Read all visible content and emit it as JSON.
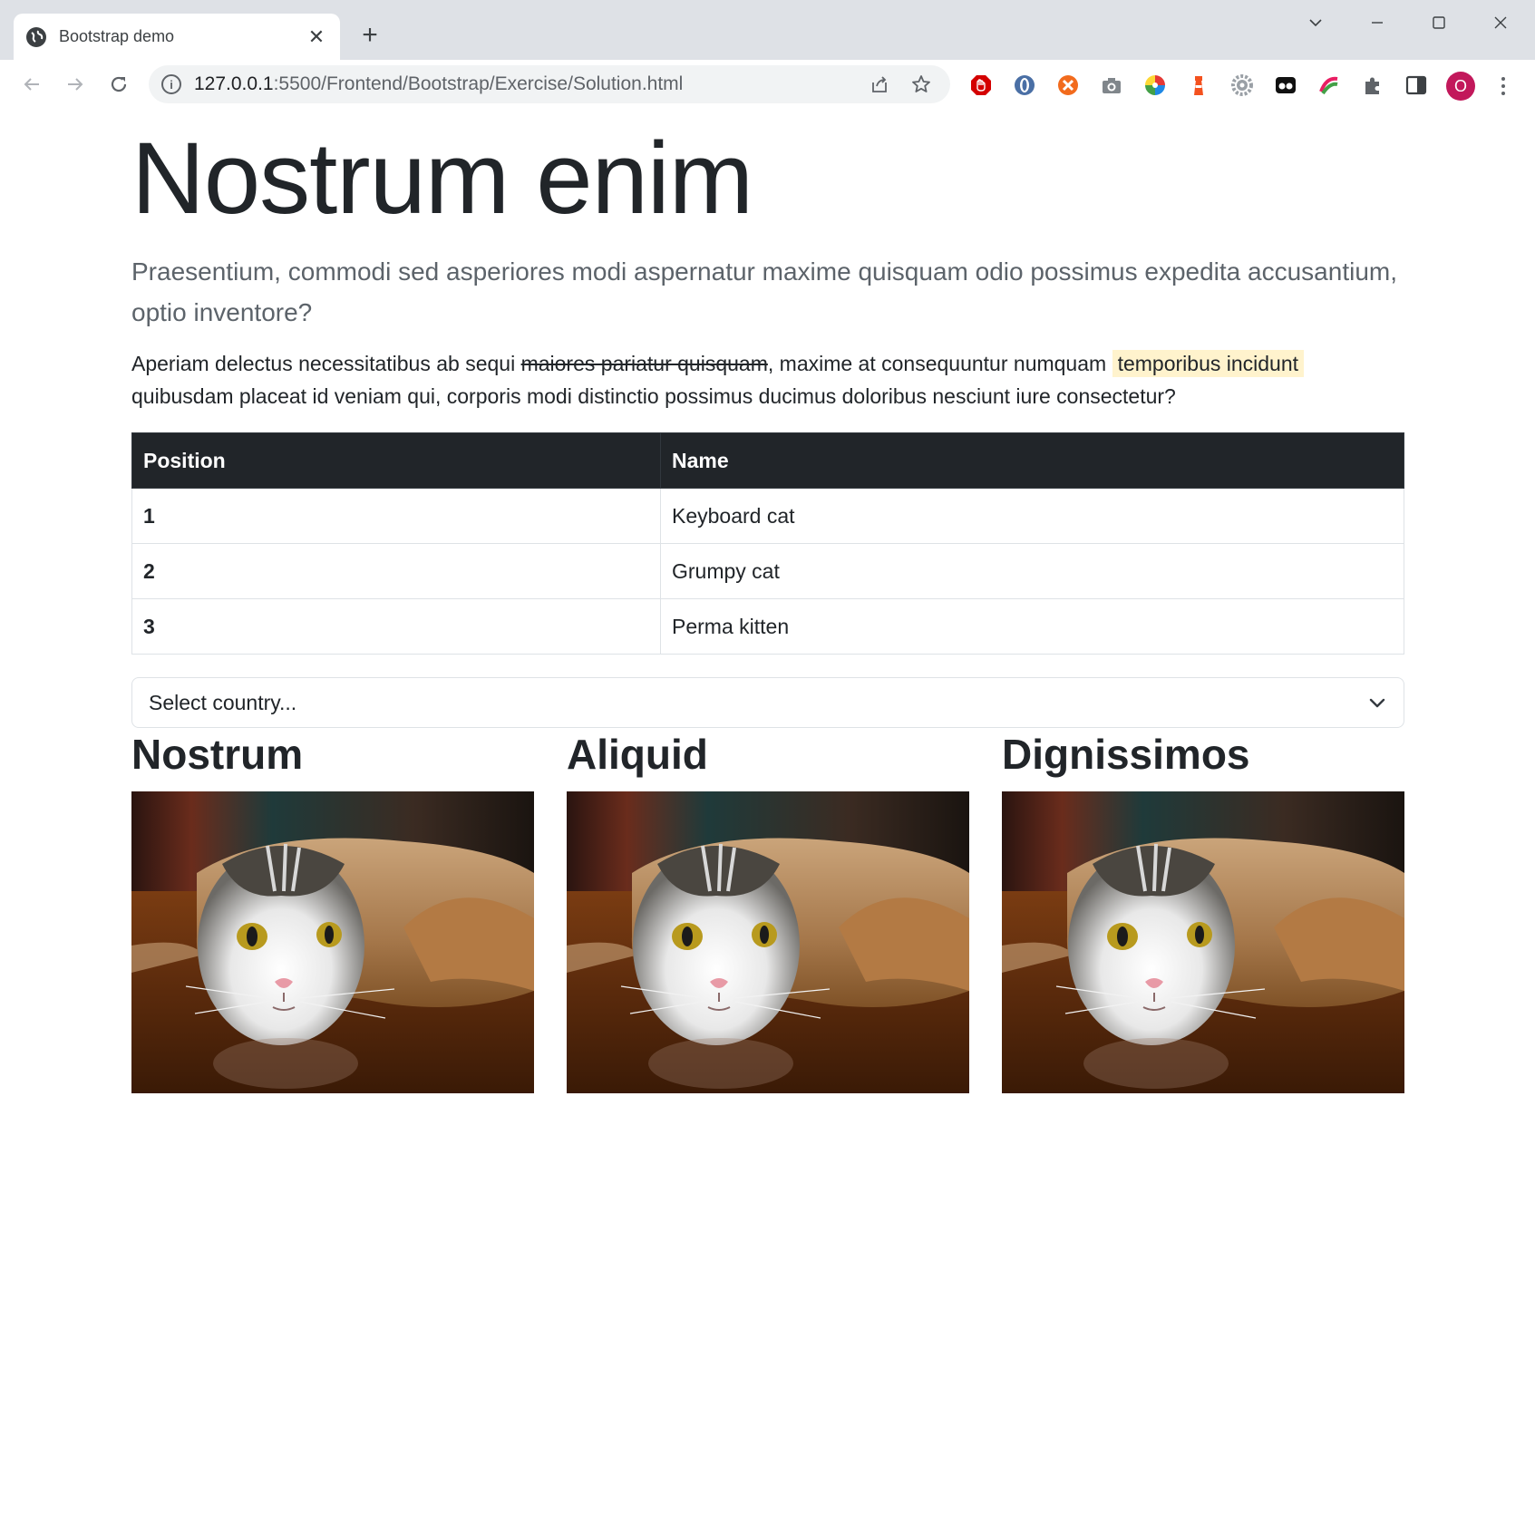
{
  "browser": {
    "tab_title": "Bootstrap demo",
    "url_host": "127.0.0.1",
    "url_rest": ":5500/Frontend/Bootstrap/Exercise/Solution.html",
    "profile_initial": "O"
  },
  "page": {
    "heading": "Nostrum enim",
    "lead": "Praesentium, commodi sed asperiores modi aspernatur maxime quisquam odio possimus expedita accusantium, optio inventore?",
    "paragraph": {
      "before_del": "Aperiam delectus necessitatibus ab sequi ",
      "deleted": "maiores pariatur quisquam",
      "middle": ", maxime at consequuntur numquam ",
      "marked": "temporibus incidunt",
      "after": " quibusdam placeat id veniam qui, corporis modi distinctio possimus ducimus doloribus nesciunt iure consectetur?"
    },
    "table": {
      "headers": [
        "Position",
        "Name"
      ],
      "rows": [
        {
          "position": "1",
          "name": "Keyboard cat"
        },
        {
          "position": "2",
          "name": "Grumpy cat"
        },
        {
          "position": "3",
          "name": "Perma kitten"
        }
      ]
    },
    "select": {
      "value": "Select country..."
    },
    "cards": [
      {
        "title": "Nostrum"
      },
      {
        "title": "Aliquid"
      },
      {
        "title": "Dignissimos"
      }
    ]
  },
  "colors": {
    "table_header_bg": "#212529",
    "mark_bg": "#fff3cd",
    "profile_bg": "#c2185b"
  }
}
